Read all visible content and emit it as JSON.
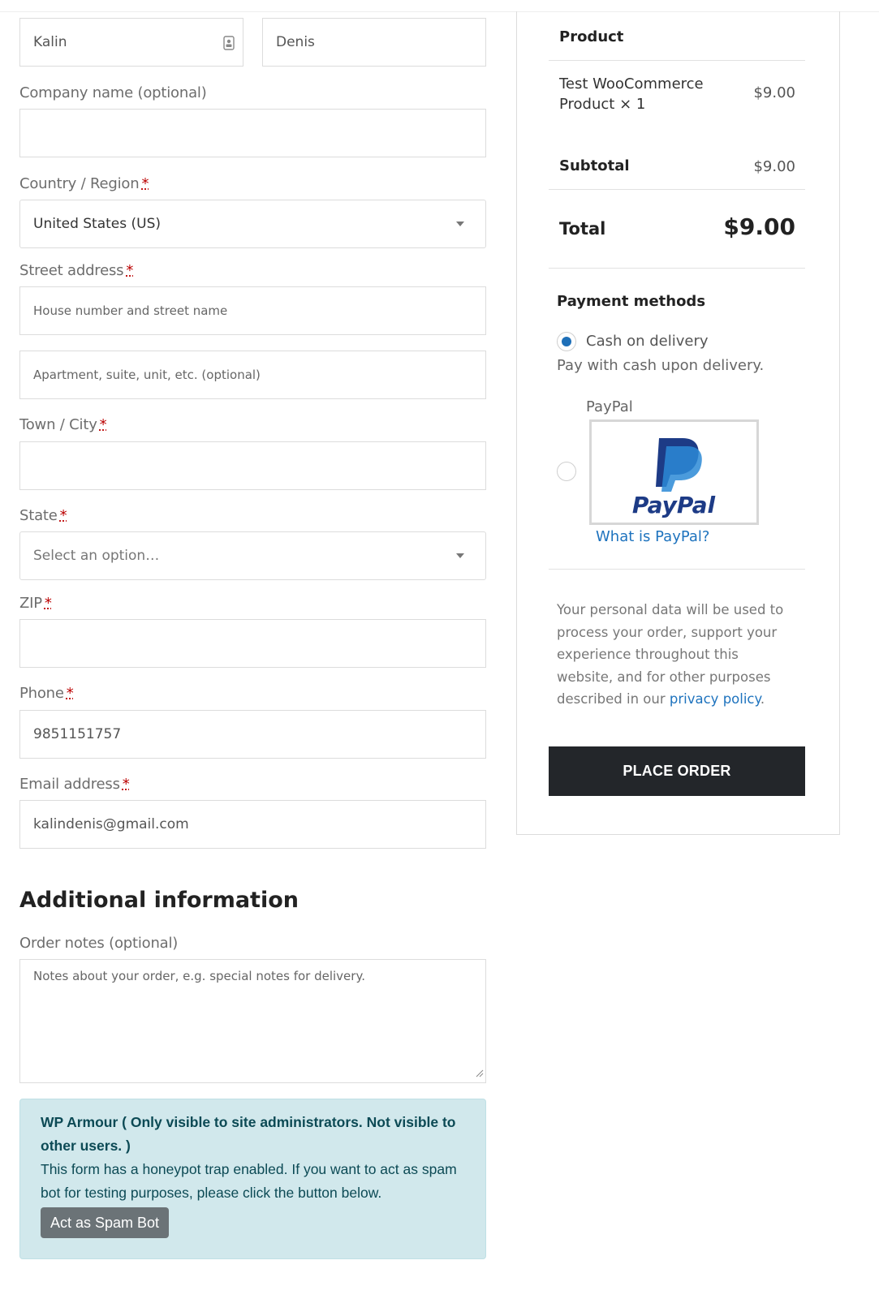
{
  "billing": {
    "first_name": "Kalin",
    "last_name": "Denis",
    "company_label": "Company name (optional)",
    "country_label": "Country / Region",
    "country_value": "United States (US)",
    "street_label": "Street address",
    "street_placeholder": "House number and street name",
    "apartment_placeholder": "Apartment, suite, unit, etc. (optional)",
    "city_label": "Town / City",
    "state_label": "State",
    "state_placeholder": "Select an option…",
    "zip_label": "ZIP",
    "phone_label": "Phone",
    "phone_value": "9851151757",
    "email_label": "Email address",
    "email_value": "kalindenis@gmail.com",
    "required_mark": "*"
  },
  "additional": {
    "heading": "Additional information",
    "notes_label": "Order notes (optional)",
    "notes_placeholder": "Notes about your order, e.g. special notes for delivery."
  },
  "wp_armour": {
    "title": "WP Armour ( Only visible to site administrators. Not visible to other users. )",
    "body": "This form has a honeypot trap enabled. If you want to act as spam bot for testing purposes, please click the button below.",
    "button": "Act as Spam Bot"
  },
  "order_summary": {
    "product_header": "Product",
    "item_name": "Test WooCommerce Product",
    "item_qty": "× 1",
    "item_price": "$9.00",
    "subtotal_label": "Subtotal",
    "subtotal_value": "$9.00",
    "total_label": "Total",
    "total_value": "$9.00"
  },
  "payment": {
    "heading": "Payment methods",
    "cod_label": "Cash on delivery",
    "cod_desc": "Pay with cash upon delivery.",
    "paypal_label": "PayPal",
    "paypal_logo_text": "PayPal",
    "paypal_link": "What is PayPal?",
    "privacy_text": "Your personal data will be used to process your order, support your experience throughout this website, and for other purposes described in our",
    "privacy_link": "privacy policy",
    "privacy_end": ".",
    "place_order": "PLACE ORDER"
  },
  "colors": {
    "accent_link": "#1e73be",
    "place_order_bg": "#23262a",
    "notice_bg": "#d1e8ec",
    "notice_text": "#0c4a55",
    "radio_selected": "#1e6fb8"
  }
}
